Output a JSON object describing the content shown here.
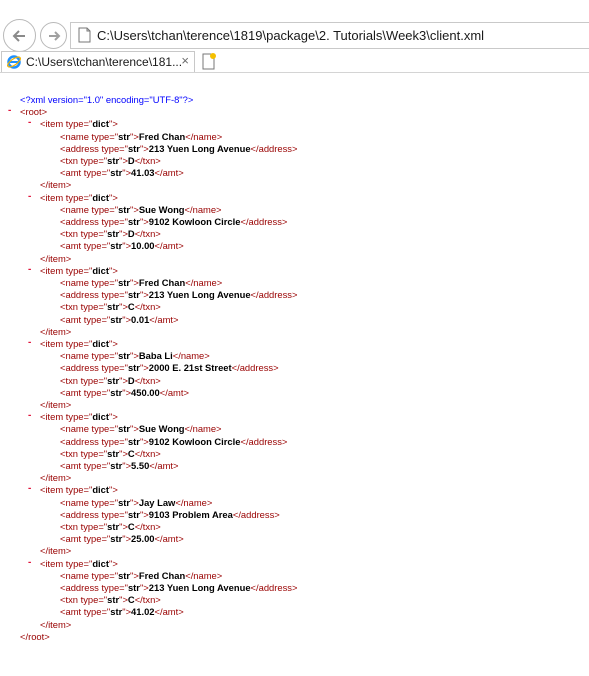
{
  "browser": {
    "address": "C:\\Users\\tchan\\terence\\1819\\package\\2. Tutorials\\Week3\\client.xml",
    "tab_title": "C:\\Users\\tchan\\terence\\181...",
    "close_glyph": "×"
  },
  "xml": {
    "declaration": "<?xml version=\"1.0\" encoding=\"UTF-8\"?>",
    "root_open": "<root>",
    "root_close": "</root>",
    "item_open_prefix": "<item type=\"",
    "item_type": "dict",
    "item_close": "</item>",
    "attr_name": "type",
    "attr_value": "str",
    "items": [
      {
        "name": "Fred Chan",
        "address": "213 Yuen Long Avenue",
        "txn": "D",
        "amt": "41.03"
      },
      {
        "name": "Sue Wong",
        "address": "9102 Kowloon Circle",
        "txn": "D",
        "amt": "10.00"
      },
      {
        "name": "Fred Chan",
        "address": "213 Yuen Long Avenue",
        "txn": "C",
        "amt": "0.01"
      },
      {
        "name": "Baba Li",
        "address": "2000 E. 21st Street",
        "txn": "D",
        "amt": "450.00"
      },
      {
        "name": "Sue Wong",
        "address": "9102 Kowloon Circle",
        "txn": "C",
        "amt": "5.50"
      },
      {
        "name": "Jay Law",
        "address": "9103 Problem Area",
        "txn": "C",
        "amt": "25.00"
      },
      {
        "name": "Fred Chan",
        "address": "213 Yuen Long Avenue",
        "txn": "C",
        "amt": "41.02"
      }
    ]
  },
  "colors": {
    "declaration": "#0000ff",
    "tag": "#990000",
    "value": "#000000",
    "toggle": "#e0143c"
  }
}
